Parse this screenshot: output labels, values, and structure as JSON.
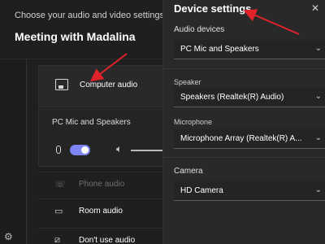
{
  "left": {
    "subtitle": "Choose your audio and video settings for",
    "meeting_title": "Meeting with Madalina",
    "computer_audio": {
      "label": "Computer audio",
      "icon": "computer-audio-icon",
      "selected": true
    },
    "device_line": "PC Mic and Speakers",
    "mic_toggle_on": true,
    "phone_audio": {
      "label": "Phone audio",
      "icon": "phone-icon",
      "disabled": true
    },
    "room_audio": {
      "label": "Room audio",
      "icon": "room-icon"
    },
    "dont_use_audio": {
      "label": "Don't use audio",
      "icon": "no-audio-icon"
    }
  },
  "right": {
    "title": "Device settings",
    "audio_devices": {
      "label": "Audio devices",
      "value": "PC Mic and Speakers"
    },
    "speaker": {
      "label": "Speaker",
      "value": "Speakers (Realtek(R) Audio)"
    },
    "microphone": {
      "label": "Microphone",
      "value": "Microphone Array (Realtek(R) A..."
    },
    "camera": {
      "label": "Camera",
      "value": "HD Camera"
    }
  },
  "colors": {
    "accent": "#7f85f5",
    "annotation_arrow": "#e0232a",
    "panel": "#292929",
    "background": "#1f1f1f"
  }
}
